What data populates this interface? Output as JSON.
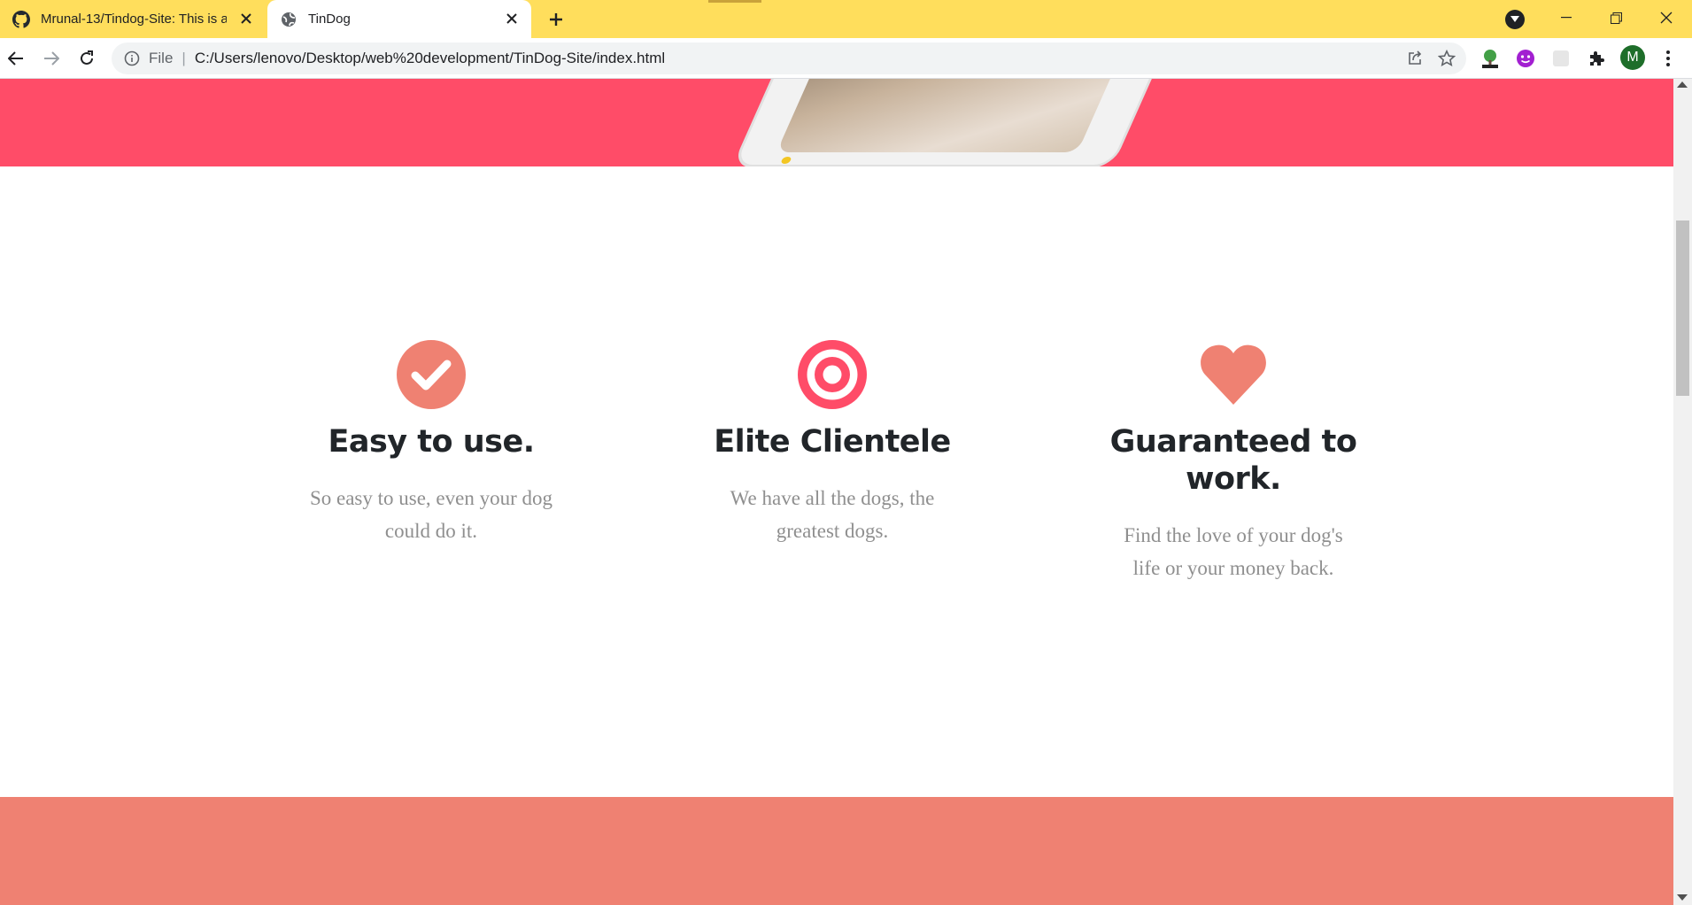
{
  "browser": {
    "tabs": [
      {
        "title": "Mrunal-13/Tindog-Site: This is a",
        "favicon": "github-icon",
        "active": false
      },
      {
        "title": "TinDog",
        "favicon": "globe-icon",
        "active": true
      }
    ],
    "omnibox": {
      "scheme_label": "File",
      "separator": "|",
      "url": "C:/Users/lenovo/Desktop/web%20development/TinDog-Site/index.html"
    },
    "profile_initial": "M",
    "colors": {
      "tabbar": "#ffde5c"
    }
  },
  "page": {
    "colors": {
      "title_band": "#ff4c68",
      "feature_icon": "#ef8172",
      "target_icon": "#ff4c68",
      "testimonial_band": "#ef8172",
      "heading": "#212529",
      "body_text": "#8f8f8f"
    },
    "features": [
      {
        "icon": "check-circle-icon",
        "title": "Easy to use.",
        "text": "So easy to use, even your dog could do it."
      },
      {
        "icon": "bullseye-icon",
        "title": "Elite Clientele",
        "text": "We have all the dogs, the greatest dogs."
      },
      {
        "icon": "heart-icon",
        "title": "Guaranteed to work.",
        "text": "Find the love of your dog's life or your money back."
      }
    ]
  }
}
